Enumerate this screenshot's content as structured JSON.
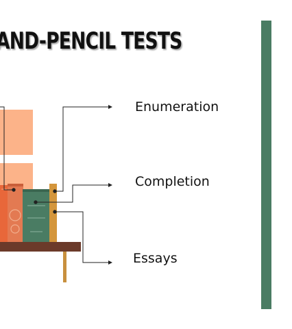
{
  "title": "AND-PENCIL TESTS",
  "labels": {
    "enumeration": "Enumeration",
    "completion": "Completion",
    "essays": "Essays"
  },
  "colors": {
    "title": "#111111",
    "side_bar": "#4a7c63",
    "shelf": "#6b3a2a",
    "shelf_leg": "#c8903e",
    "book_orange": "#e8673a",
    "book_salmon": "#e37a52",
    "book_green": "#4a7c63",
    "book_gold": "#d4963c",
    "panel_peach": "#fcb389",
    "connector": "#222222"
  }
}
